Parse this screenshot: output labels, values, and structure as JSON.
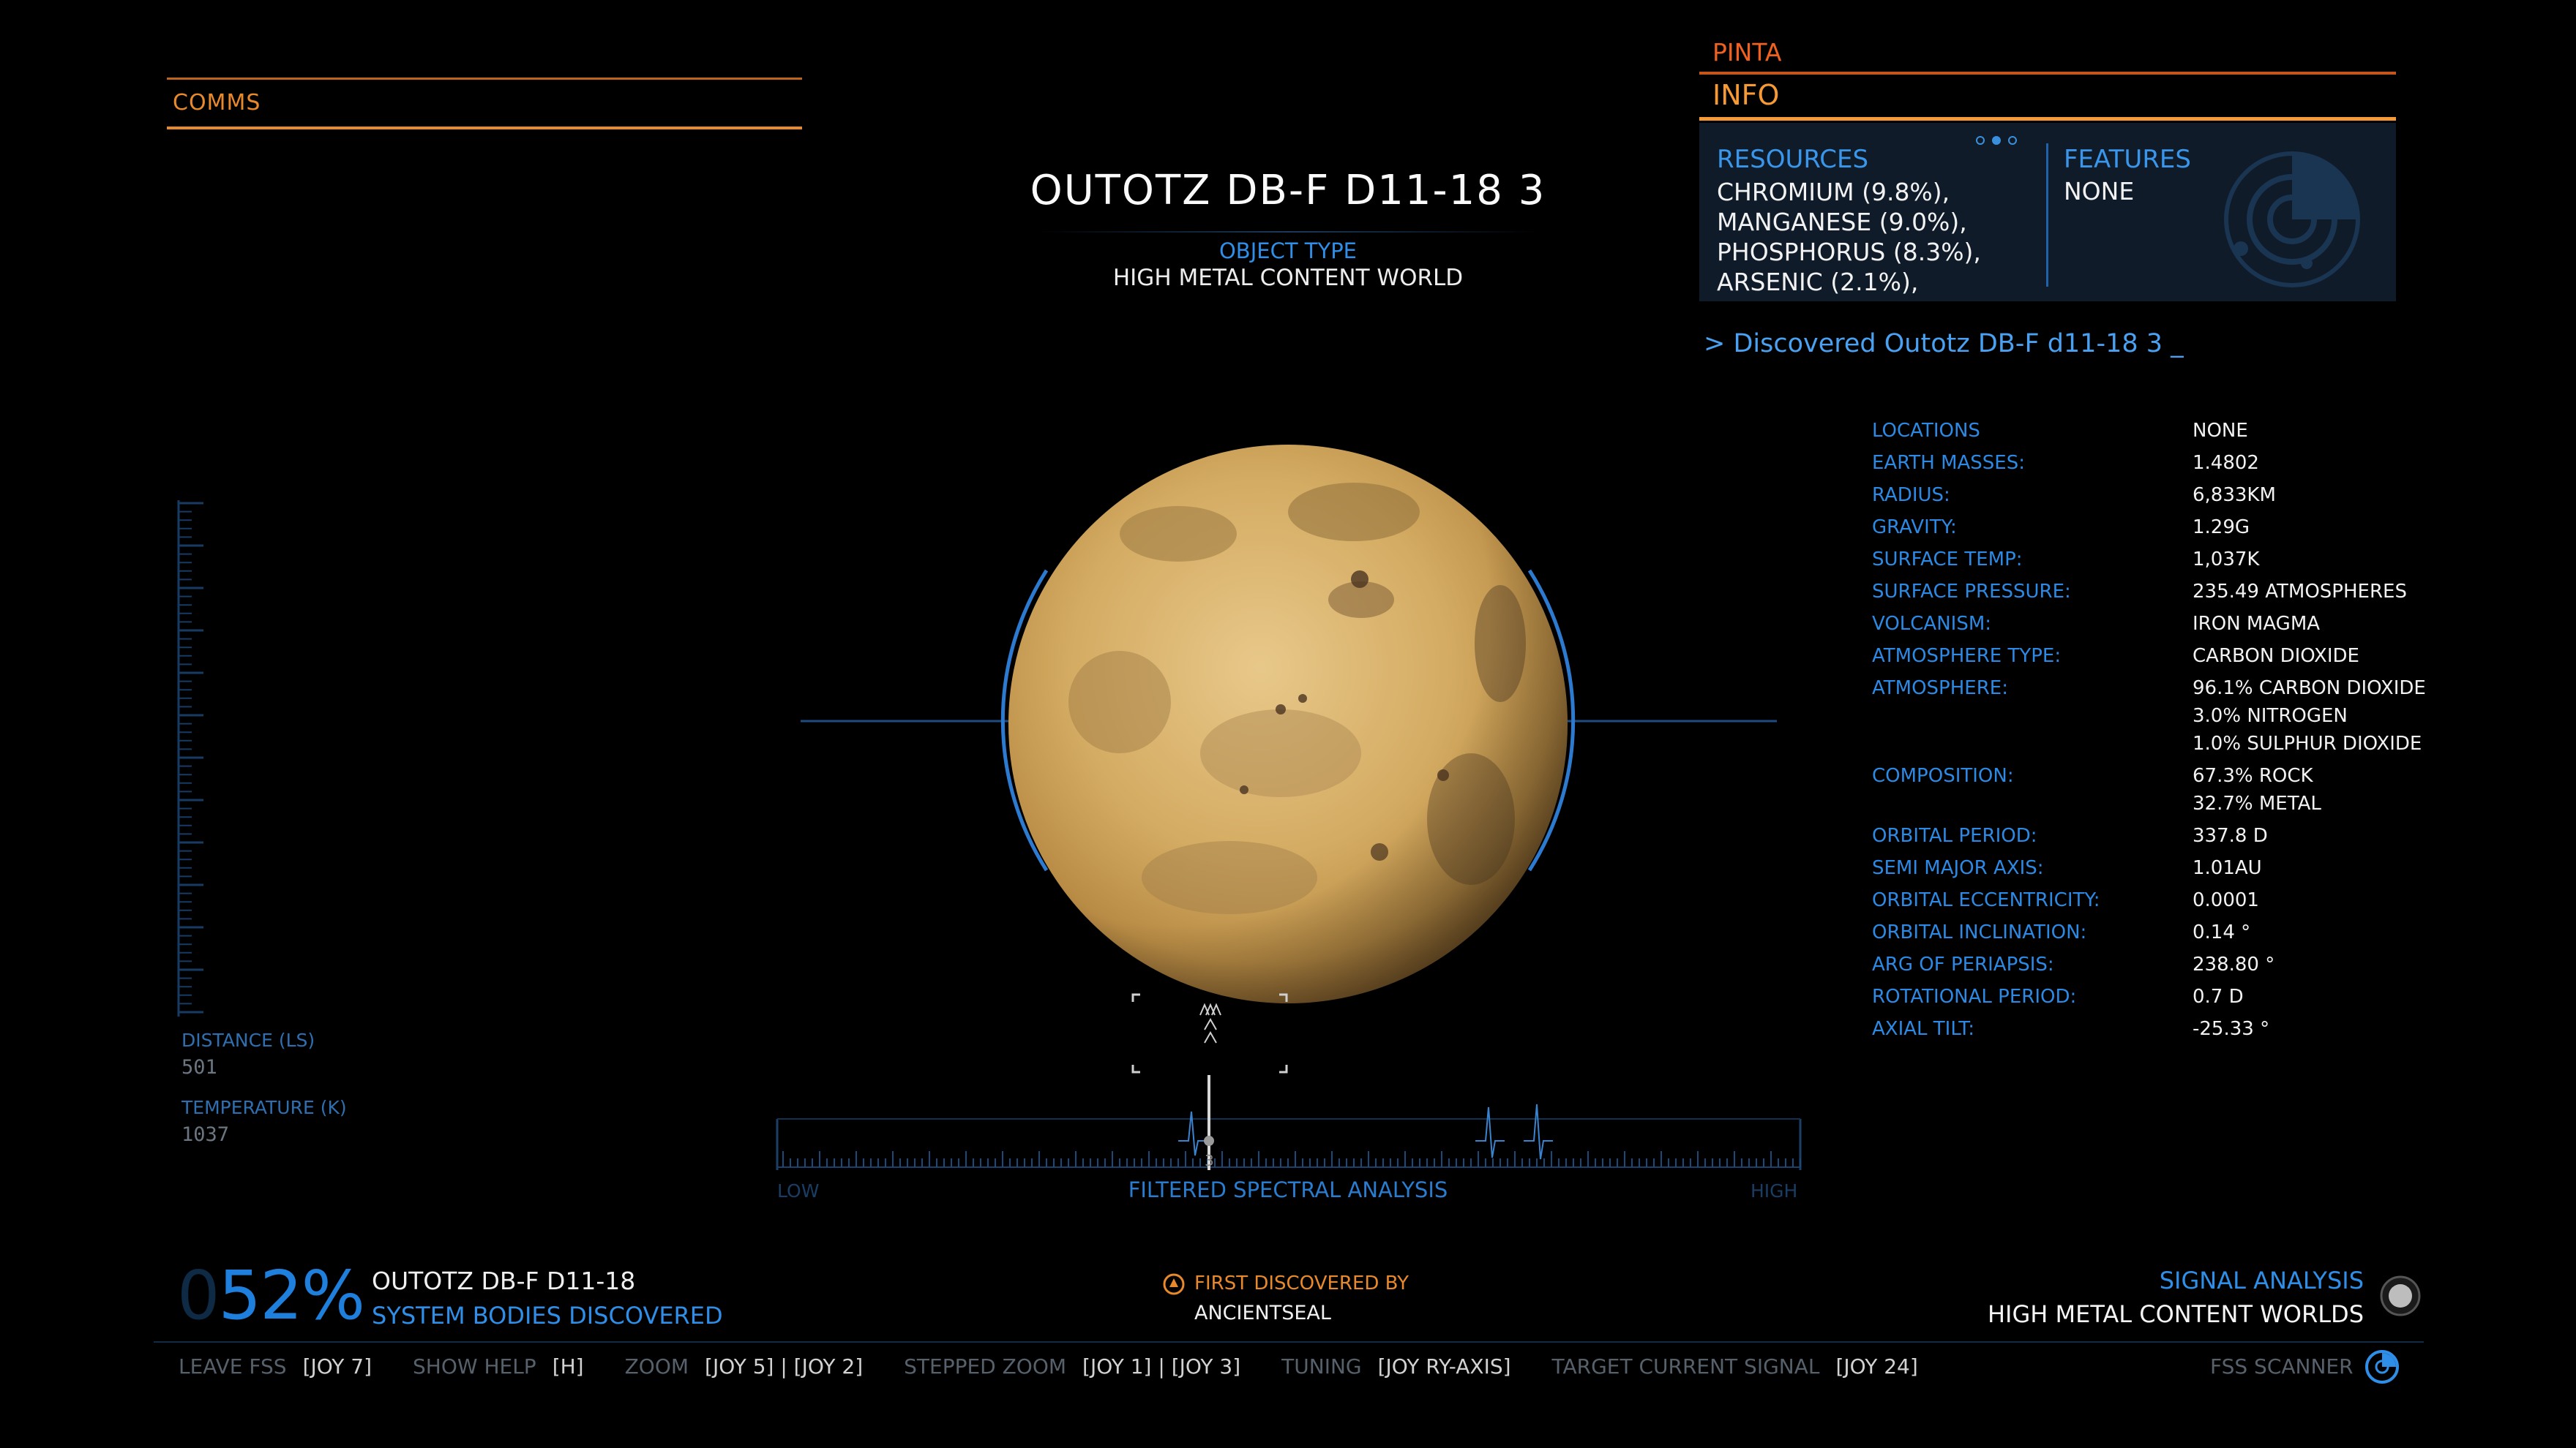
{
  "comms": {
    "label": "COMMS"
  },
  "body": {
    "title": "OUTOTZ DB-F D11-18 3",
    "object_type_label": "OBJECT TYPE",
    "object_type_value": "HIGH METAL CONTENT WORLD"
  },
  "info_panel": {
    "target_name": "PINTA",
    "header": "INFO",
    "resources_label": "RESOURCES",
    "resources": [
      "CHROMIUM (9.8%),",
      "MANGANESE (9.0%),",
      "PHOSPHORUS (8.3%),",
      "ARSENIC (2.1%),"
    ],
    "features_label": "FEATURES",
    "features_value": "NONE",
    "discovered_line": "> Discovered Outotz DB-F d11-18 3 _"
  },
  "stats": [
    {
      "label": "LOCATIONS",
      "values": [
        "NONE"
      ]
    },
    {
      "label": "EARTH MASSES:",
      "values": [
        "1.4802"
      ]
    },
    {
      "label": "RADIUS:",
      "values": [
        "6,833KM"
      ]
    },
    {
      "label": "GRAVITY:",
      "values": [
        "1.29G"
      ]
    },
    {
      "label": "SURFACE TEMP:",
      "values": [
        "1,037K"
      ]
    },
    {
      "label": "SURFACE PRESSURE:",
      "values": [
        "235.49 ATMOSPHERES"
      ]
    },
    {
      "label": "VOLCANISM:",
      "values": [
        "IRON MAGMA"
      ]
    },
    {
      "label": "ATMOSPHERE TYPE:",
      "values": [
        "CARBON DIOXIDE"
      ]
    },
    {
      "label": "ATMOSPHERE:",
      "values": [
        "96.1% CARBON DIOXIDE",
        "3.0% NITROGEN",
        "1.0% SULPHUR DIOXIDE"
      ]
    },
    {
      "label": "COMPOSITION:",
      "values": [
        "67.3% ROCK",
        "32.7% METAL"
      ]
    },
    {
      "label": "ORBITAL PERIOD:",
      "values": [
        "337.8 D"
      ]
    },
    {
      "label": "SEMI MAJOR AXIS:",
      "values": [
        "1.01AU"
      ]
    },
    {
      "label": "ORBITAL ECCENTRICITY:",
      "values": [
        "0.0001"
      ]
    },
    {
      "label": "ORBITAL INCLINATION:",
      "values": [
        "0.14 °"
      ]
    },
    {
      "label": "ARG OF PERIAPSIS:",
      "values": [
        "238.80 °"
      ]
    },
    {
      "label": "ROTATIONAL PERIOD:",
      "values": [
        "0.7 D"
      ]
    },
    {
      "label": "AXIAL TILT:",
      "values": [
        "-25.33 °"
      ]
    }
  ],
  "gauge": {
    "distance_label": "DISTANCE (LS)",
    "distance_value": "501",
    "temperature_label": "TEMPERATURE (K)",
    "temperature_value": "1037"
  },
  "spectral": {
    "title": "FILTERED SPECTRAL ANALYSIS",
    "low_label": "LOW",
    "high_label": "HIGH",
    "marker_value": "3"
  },
  "discovery": {
    "percent_ghost": "0",
    "percent_number": "52%",
    "system_name": "OUTOTZ DB-F D11-18",
    "subtitle": "SYSTEM BODIES DISCOVERED",
    "first_discovered_label": "FIRST DISCOVERED BY",
    "first_discovered_name": "ANCIENTSEAL"
  },
  "signal": {
    "label": "SIGNAL ANALYSIS",
    "value": "HIGH METAL CONTENT WORLDS"
  },
  "controls": [
    {
      "label": "LEAVE FSS",
      "key": "[JOY 7]"
    },
    {
      "label": "SHOW HELP",
      "key": "[H]"
    },
    {
      "label": "ZOOM",
      "key": "[JOY 5] |  [JOY 2]"
    },
    {
      "label": "STEPPED ZOOM",
      "key": "[JOY 1] |  [JOY 3]"
    },
    {
      "label": "TUNING",
      "key": "[JOY RY-AXIS]"
    },
    {
      "label": "TARGET CURRENT SIGNAL",
      "key": "[JOY 24]"
    }
  ],
  "fss_label": "FSS SCANNER",
  "colors": {
    "orange": "#e8892c",
    "blue": "#2f8fe8",
    "planet": "#d9b46d"
  }
}
